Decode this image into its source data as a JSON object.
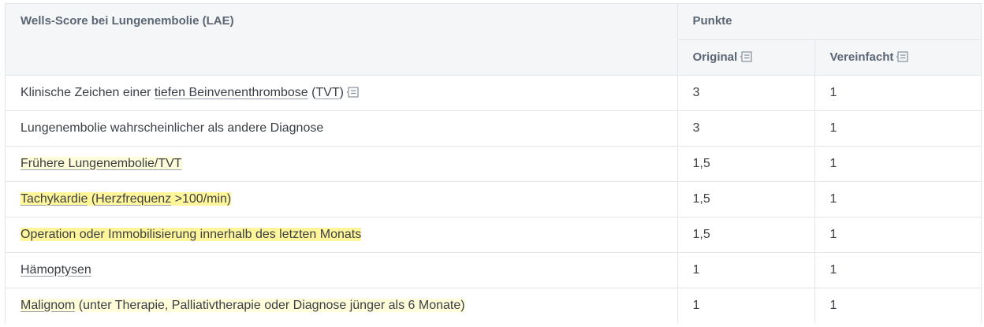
{
  "table": {
    "title": "Wells-Score bei Lungenembolie (LAE)",
    "points_header": "Punkte",
    "col_original": "Original",
    "col_simplified": "Vereinfacht",
    "rows": [
      {
        "criterion": {
          "pre": "Klinische Zeichen einer ",
          "link1": "tiefen Beinvenenthrombose",
          "mid": " (",
          "link2": "TVT",
          "post": ")"
        },
        "original": "3",
        "simplified": "1"
      },
      {
        "criterion": "Lungenembolie wahrscheinlicher als andere Diagnose",
        "original": "3",
        "simplified": "1"
      },
      {
        "criterion": {
          "part1": "Frühere Lungenembolie/",
          "link": "TVT"
        },
        "original": "1,5",
        "simplified": "1"
      },
      {
        "criterion": {
          "link1": "Tachykardie",
          "mid": " (",
          "link2": "Herzfrequenz",
          "post": " >100/min)"
        },
        "original": "1,5",
        "simplified": "1"
      },
      {
        "criterion": "Operation oder Immobilisierung innerhalb des letzten Monats",
        "original": "1,5",
        "simplified": "1"
      },
      {
        "criterion": "Hämoptysen",
        "original": "1",
        "simplified": "1"
      },
      {
        "criterion": {
          "link": "Malignom",
          "post": " (unter Therapie, Palliativtherapie oder Diagnose jünger als 6 Monate)"
        },
        "original": "1",
        "simplified": "1"
      }
    ]
  },
  "colors": {
    "highlight": "#fff59a",
    "highlight_soft": "#fffcd9",
    "header_bg": "#f4f6f8",
    "border": "#e2e5e9"
  }
}
